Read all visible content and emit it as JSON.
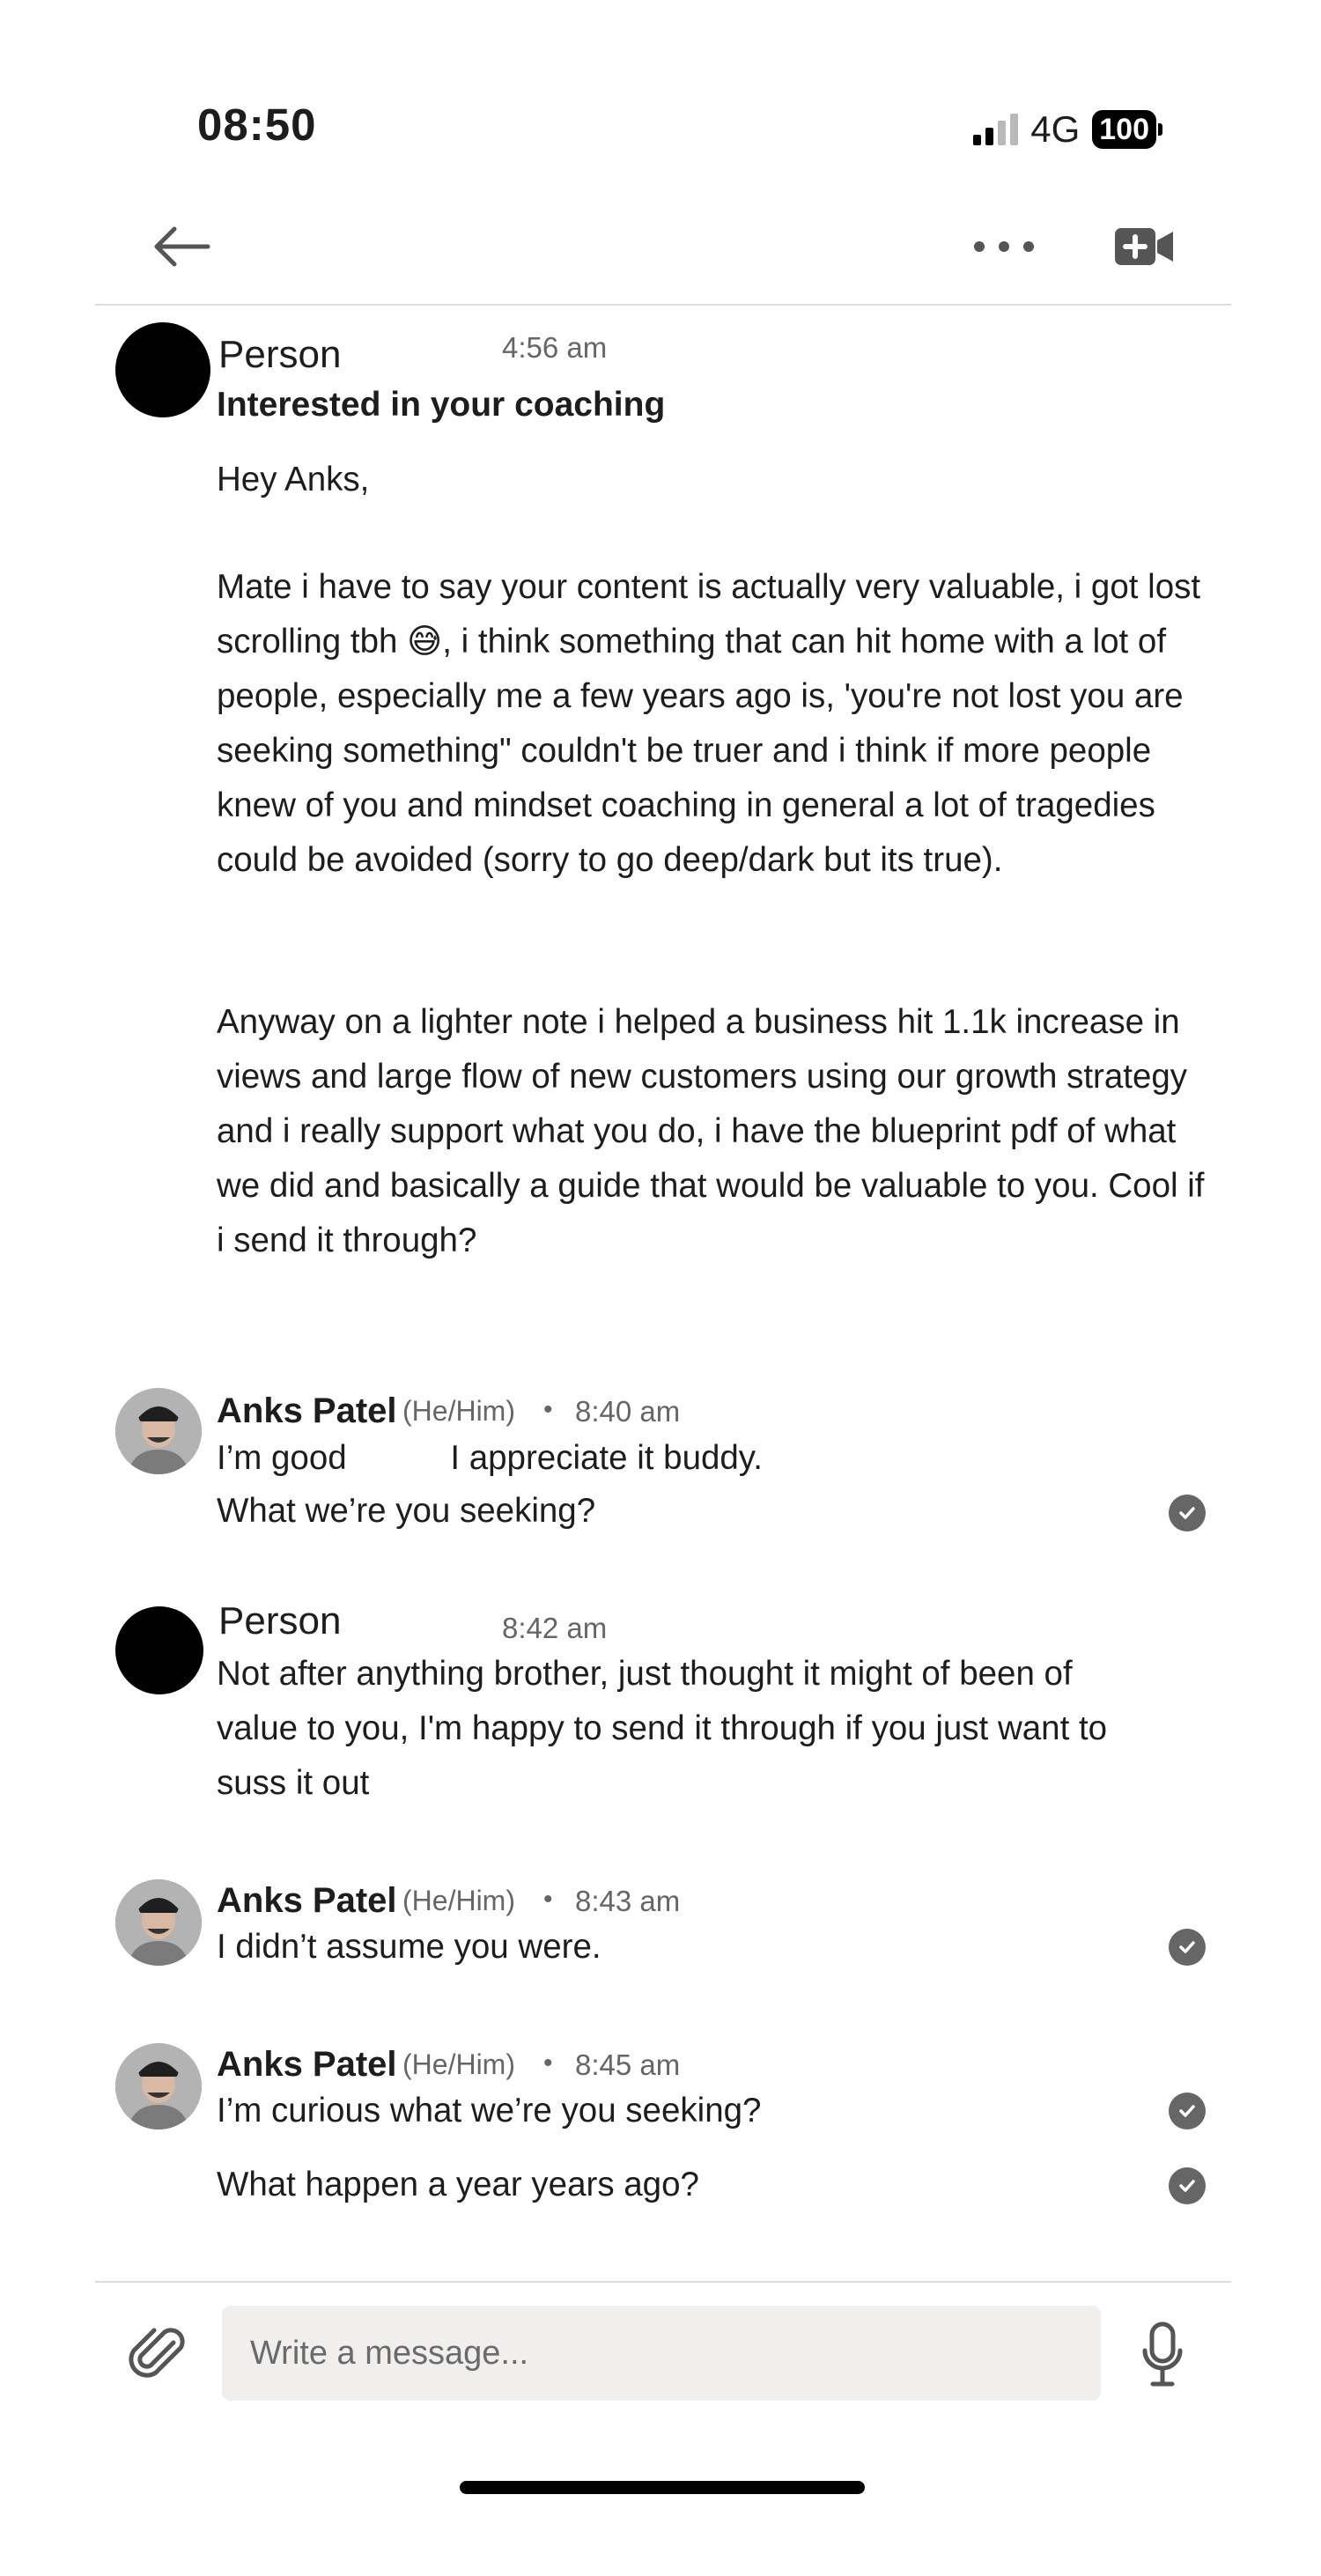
{
  "status_bar": {
    "time": "08:50",
    "network": "4G",
    "battery": "100"
  },
  "header": {
    "back_icon": "arrow-left-icon",
    "more_icon": "more-horizontal-icon",
    "video_icon": "video-plus-icon"
  },
  "messages": [
    {
      "sender": "Person",
      "time": "4:56 am",
      "subject": "Interested in your coaching",
      "paragraphs": [
        "Hey Anks,",
        "Mate i have to say your content is actually very valuable, i got lost scrolling tbh 😅, i think something that can hit home with a lot of people, especially me a few years ago is, 'you're not lost you are seeking something\" couldn't be truer and i think if more people knew of you and mindset coaching in general a lot of tragedies could be avoided (sorry to go deep/dark but its true).",
        "Anyway on a lighter note i helped a business hit 1.1k increase in views and large flow of new customers using our growth strategy and i really support what you do, i have the blueprint pdf of what we did and basically a guide that would be valuable to you. Cool if i send it through?"
      ]
    },
    {
      "sender": "Anks Patel",
      "pronouns": "(He/Him)",
      "separator": "•",
      "time": "8:40 am",
      "lines": [
        "I’m good           I appreciate it buddy.",
        "What we’re you seeking?"
      ]
    },
    {
      "sender": "Person",
      "time": "8:42 am",
      "text": "Not after anything brother, just thought it might of been of value to you, I'm happy to send it through if you just want to suss it out"
    },
    {
      "sender": "Anks Patel",
      "pronouns": "(He/Him)",
      "separator": "•",
      "time": "8:43 am",
      "text": "I didn’t assume you were."
    },
    {
      "sender": "Anks Patel",
      "pronouns": "(He/Him)",
      "separator": "•",
      "time": "8:45 am",
      "lines": [
        "I’m curious what we’re you seeking?",
        "What happen a year years ago?"
      ]
    }
  ],
  "composer": {
    "placeholder": "Write a message...",
    "attach_icon": "paperclip-icon",
    "mic_icon": "microphone-icon"
  },
  "colors": {
    "meta_text": "#666666",
    "composer_bg": "#f0efed",
    "divider": "#dcdcdc"
  }
}
